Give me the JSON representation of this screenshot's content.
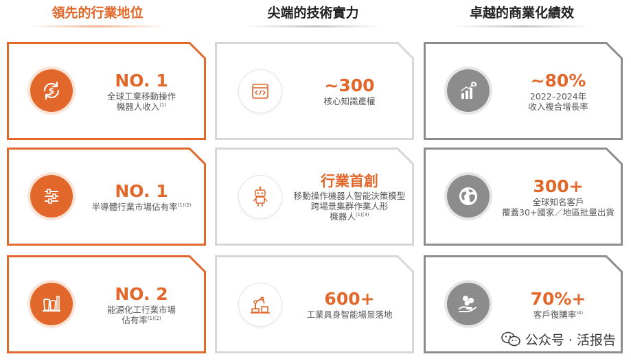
{
  "columns": [
    {
      "title": "領先的行業地位",
      "title_color": "#e1672a"
    },
    {
      "title": "尖端的技術實力",
      "title_color": "#222222"
    },
    {
      "title": "卓越的商業化績效",
      "title_color": "#222222"
    }
  ],
  "cards": {
    "c1r1": {
      "headline": "NO. 1",
      "desc_lines": [
        "全球工業移動操作",
        "機器人收入"
      ],
      "note": "(1)",
      "icon": "dollar-cycle-icon"
    },
    "c1r2": {
      "headline": "NO. 1",
      "desc_lines": [
        "半導體行業市場佔有率"
      ],
      "note": "(1)(2)",
      "icon": "sliders-icon"
    },
    "c1r3": {
      "headline": "NO. 2",
      "desc_lines": [
        "能源化工行業市場",
        "佔有率"
      ],
      "note": "(1)(2)",
      "icon": "factory-icon"
    },
    "c2r1": {
      "headline": "~300",
      "desc_lines": [
        "核心知識產權"
      ],
      "icon": "code-window-icon"
    },
    "c2r2": {
      "headline": "行業首創",
      "desc_lines": [
        "移動操作機器人智能決策模型",
        "跨場景集群作業人形",
        "機器人"
      ],
      "note": "(1)(3)",
      "icon": "robot-icon"
    },
    "c2r3": {
      "headline": "600+",
      "desc_lines": [
        "工業具身智能場景落地"
      ],
      "icon": "industrial-robot-icon"
    },
    "c3r1": {
      "headline": "~80%",
      "desc_lines": [
        "2022–2024年",
        "收入複合增長率"
      ],
      "icon": "growth-chart-icon"
    },
    "c3r2": {
      "headline": "300+",
      "desc_lines": [
        "全球知名客戶",
        "覆蓋30+國家／地區批量出貨"
      ],
      "icon": "globe-icon"
    },
    "c3r3": {
      "headline": "70%+",
      "desc_lines": [
        "客戶復購率"
      ],
      "note": "(4)",
      "icon": "hand-coins-icon"
    }
  },
  "colors": {
    "accent": "#e1672a",
    "accent_light": "#fbe3d6",
    "gray": "#8c8c8c",
    "border_gray": "#cfcfcf"
  },
  "watermark": {
    "text": "公众号 · 活报告",
    "icon": "wechat-icon"
  }
}
